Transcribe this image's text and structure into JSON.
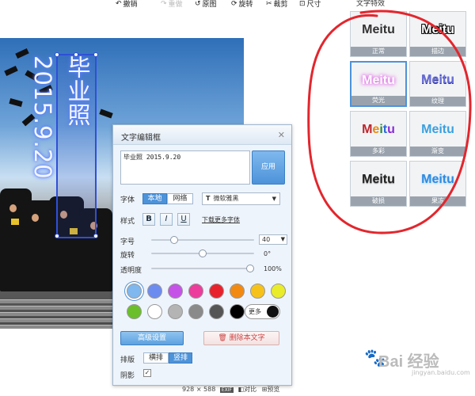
{
  "toolbar": {
    "undo": "撤销",
    "redo": "重做",
    "original": "原图",
    "rotate": "旋转",
    "crop": "裁剪",
    "size": "尺寸"
  },
  "photo_text": "毕业照 2015.9.20",
  "dialog": {
    "title": "文字编辑框",
    "text_value": "毕业照 2015.9.20",
    "apply": "应用",
    "font_label": "字体",
    "font_local": "本地",
    "font_web": "网络",
    "font_name": "微软雅黑",
    "style_label": "样式",
    "bold": "B",
    "italic": "I",
    "underline": "U",
    "download_fonts": "下载更多字体",
    "size_label": "字号",
    "size_value": "40",
    "rotate_label": "旋转",
    "rotate_value": "0°",
    "opacity_label": "透明度",
    "opacity_value": "100%",
    "more": "更多",
    "advanced": "高级设置",
    "delete": "删除本文字",
    "layout_label": "排版",
    "layout_horizontal": "横排",
    "layout_vertical": "竖排",
    "shadow_label": "阴影",
    "shadow_checked": "✓"
  },
  "sliders": {
    "size_fraction": 0.2,
    "rotate_fraction": 0.5,
    "opacity_fraction": 1.0
  },
  "colors": {
    "row1": [
      "#7fb8ee",
      "#6d8cf0",
      "#c653e8",
      "#ec3d9c",
      "#e8222c",
      "#f28a12",
      "#f6c21a",
      "#e9ec2a"
    ],
    "row2": [
      "#6abf2a",
      "#ffffff",
      "#b4b4b4",
      "#8a8a8a",
      "#555555",
      "#000000"
    ],
    "selected_index": 0
  },
  "status": {
    "dimensions": "928 × 588",
    "exif": "EXIF",
    "compare": "对比",
    "preview": "预览"
  },
  "styles_panel": {
    "title": "文字特效",
    "tiles": [
      {
        "text": "Meitu",
        "name": "正常"
      },
      {
        "text": "Meitu",
        "name": "描边"
      },
      {
        "text": "Meitu",
        "name": "荧光"
      },
      {
        "text": "Meitu",
        "name": "纹理"
      },
      {
        "text": "Meitu",
        "name": "多彩"
      },
      {
        "text": "Meitu",
        "name": "渐变"
      },
      {
        "text": "Meitu",
        "name": "破损"
      },
      {
        "text": "Meitu",
        "name": "果冻"
      }
    ],
    "selected_index": 2
  },
  "watermark": {
    "brand": "Bai 经验",
    "sub": "jingyan.baidu.com"
  }
}
